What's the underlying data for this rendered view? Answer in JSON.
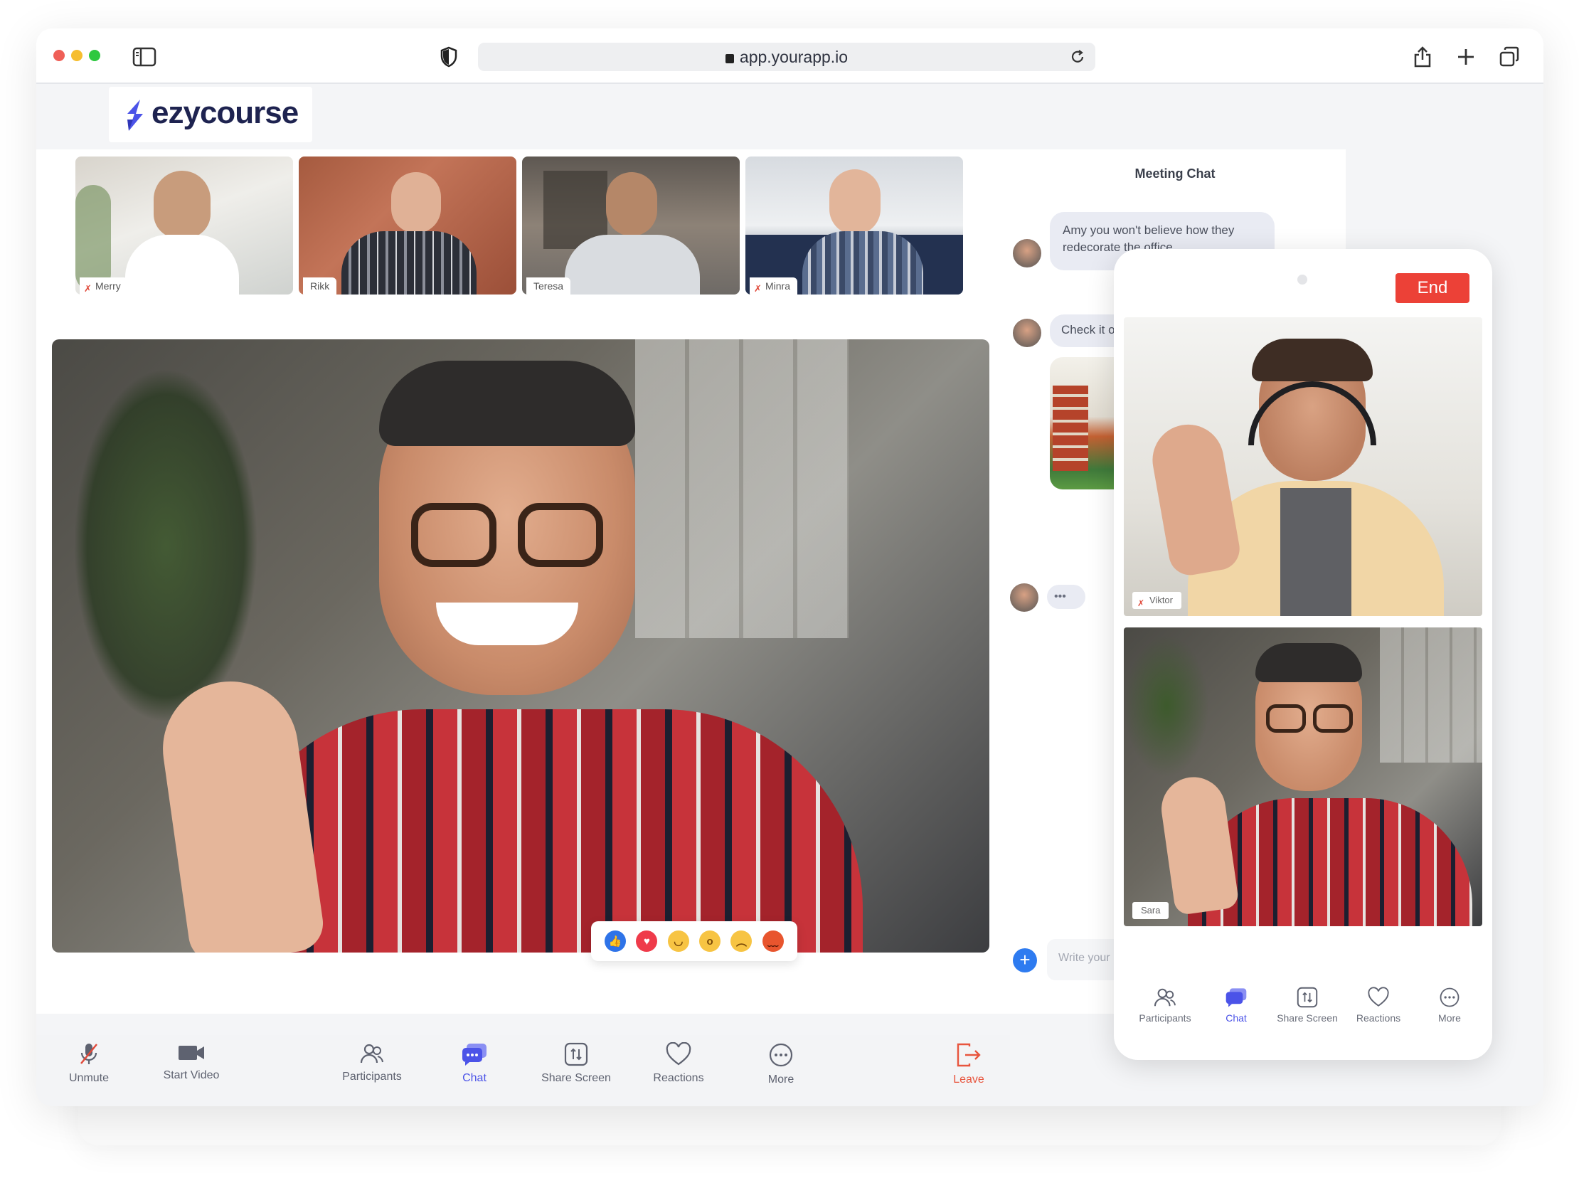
{
  "browser": {
    "url": "app.yourapp.io"
  },
  "brand": {
    "name": "ezycourse",
    "color": "#4b53e8"
  },
  "participants": [
    {
      "name": "Merry",
      "muted": true
    },
    {
      "name": "Rikk",
      "muted": false
    },
    {
      "name": "Teresa",
      "muted": false
    },
    {
      "name": "Minra",
      "muted": true
    }
  ],
  "reactions": [
    "like",
    "heart",
    "laugh",
    "wow",
    "sad",
    "angry"
  ],
  "toolbar": {
    "unmute": "Unmute",
    "start_video": "Start Video",
    "participants": "Participants",
    "chat": "Chat",
    "share_screen": "Share Screen",
    "reactions": "Reactions",
    "more": "More",
    "leave": "Leave"
  },
  "chat": {
    "title": "Meeting Chat",
    "messages": [
      {
        "text": "Amy you won't believe how they redecorate the office"
      },
      {
        "text": "Check it out..."
      }
    ],
    "typing": "•••",
    "input_placeholder": "Write your message"
  },
  "mobile": {
    "end_label": "End",
    "videos": [
      {
        "name": "Viktor"
      },
      {
        "name": "Sara"
      }
    ],
    "toolbar": {
      "participants": "Participants",
      "chat": "Chat",
      "share_screen": "Share Screen",
      "reactions": "Reactions",
      "more": "More"
    }
  },
  "colors": {
    "accent": "#4b53e8",
    "leave": "#e8553e",
    "end": "#ec4137"
  }
}
